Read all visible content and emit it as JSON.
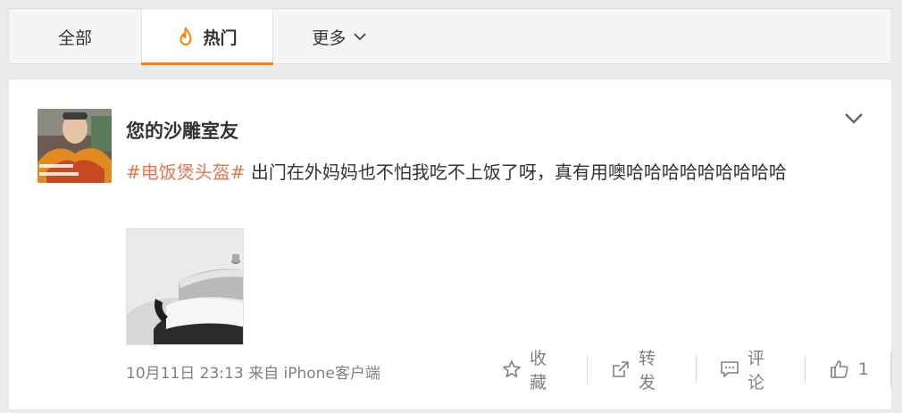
{
  "tabs": {
    "all_label": "全部",
    "hot_label": "热门",
    "more_label": "更多"
  },
  "post": {
    "username": "您的沙雕室友",
    "hashtag": "#电饭煲头盔#",
    "text": " 出门在外妈妈也不怕我吃不上饭了呀，真有用噢哈哈哈哈哈哈哈哈哈",
    "time": "10月11日 23:13",
    "source_prefix": "来自",
    "source": "iPhone客户端"
  },
  "actions": {
    "favorite_label": "收藏",
    "repost_label": "转发",
    "comment_label": "评论",
    "like_count": "1"
  },
  "icons": {
    "hot": "fire-icon",
    "more": "chevron-down-icon",
    "caret": "chevron-down-icon",
    "favorite": "star-icon",
    "repost": "share-arrow-icon",
    "comment": "comment-icon",
    "like": "thumbs-up-icon"
  },
  "colors": {
    "accent": "#ff8200",
    "hashtag": "#eb7350",
    "meta_text": "#808080"
  }
}
